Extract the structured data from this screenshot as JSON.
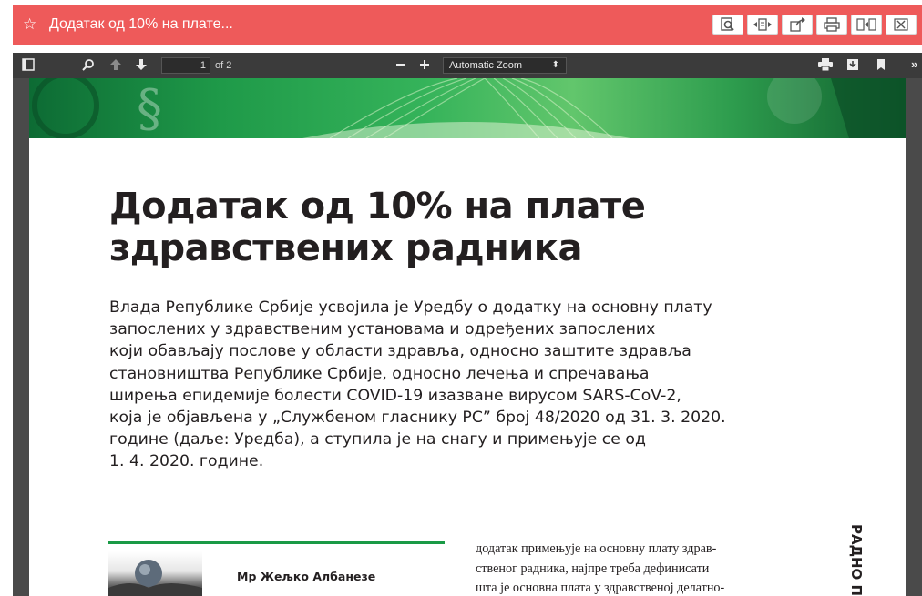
{
  "window": {
    "title": "Додатак од 10% на плате...",
    "star_icon": "star-outline-icon",
    "background_color": "#ee5a5a"
  },
  "title_buttons": [
    {
      "name": "find-in-page-button",
      "icon": "magnifier-document-icon"
    },
    {
      "name": "fit-width-button",
      "icon": "fit-width-arrows-icon"
    },
    {
      "name": "share-button",
      "icon": "share-document-icon"
    },
    {
      "name": "print-button",
      "icon": "printer-icon"
    },
    {
      "name": "split-view-button",
      "icon": "split-view-icon"
    },
    {
      "name": "close-button",
      "icon": "close-x-icon"
    }
  ],
  "pdf_toolbar": {
    "page_current": "1",
    "page_of": "of 2",
    "zoom_label": "Automatic Zoom"
  },
  "document": {
    "title": "Додатак од 10% на плате здравствених радника",
    "lead_lines": [
      "Влада Републике Србије усвојила је Уредбу о додатку на основну плату",
      "запослених у здравственим установама и одређених запослених",
      "који обављају послове у области здравља, односно заштите здравља",
      "становништва Републике Србије, односно лечења и спречавања",
      "ширења епидемије болести COVID-19 изазване вирусом SARS-CoV-2,",
      "која је објављена у „Службеном гласнику РС” број 48/2020 од 31. 3. 2020.",
      "године (даље: Уредба), а ступила је на снагу и примењује се од",
      "1. 4. 2020. године."
    ],
    "author": "Мр Жељко Албанезе",
    "body_lines": [
      "додатак примењује на основну плату здрав-",
      "ственог радника, најпре треба дефинисати",
      "шта је основна плата у здравственој делатно-"
    ],
    "side_label": "РАДНО П",
    "accent_color": "#1a9a46"
  }
}
